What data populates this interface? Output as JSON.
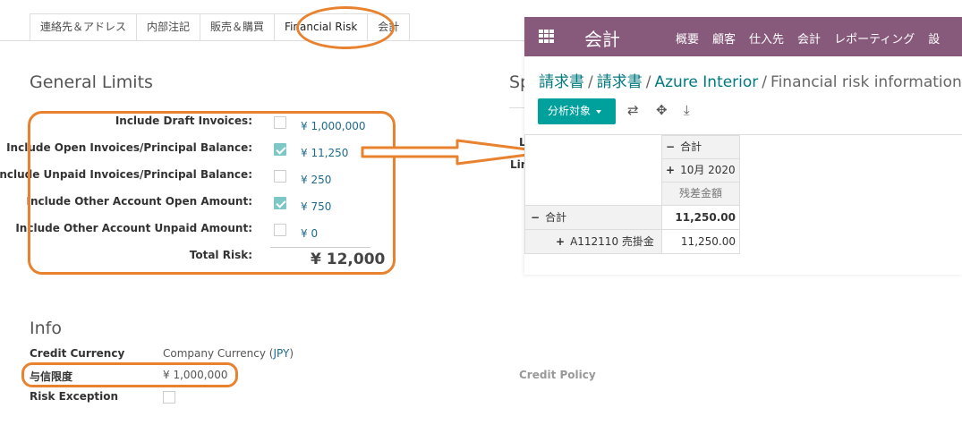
{
  "tabs": [
    "連絡先＆アドレス",
    "内部注記",
    "販売＆購買",
    "Financial Risk",
    "会計"
  ],
  "general_limits": {
    "title": "General Limits",
    "rows": [
      {
        "label": "Include Draft Invoices:",
        "checked": false,
        "amount": "¥ 1,000,000"
      },
      {
        "label": "Include Open Invoices/Principal Balance:",
        "checked": true,
        "amount": "¥ 11,250"
      },
      {
        "label": "Include Unpaid Invoices/Principal Balance:",
        "checked": false,
        "amount": "¥ 250"
      },
      {
        "label": "Include Other Account Open Amount:",
        "checked": true,
        "amount": "¥ 750"
      },
      {
        "label": "Include Other Account Unpaid Amount:",
        "checked": false,
        "amount": "¥ 0"
      }
    ],
    "total_label": "Total Risk:",
    "total_amount": "¥ 12,000"
  },
  "side_section": {
    "title_fragment": "Sp",
    "label_1": "L",
    "label_2": "Lin"
  },
  "info": {
    "title": "Info",
    "credit_currency_label": "Credit Currency",
    "credit_currency_value": "Company Currency (",
    "credit_currency_link": "JPY",
    "credit_currency_close": ")",
    "credit_limit_label": "与信限度",
    "credit_limit_value": "¥ 1,000,000",
    "risk_exception_label": "Risk Exception",
    "credit_policy_label": "Credit Policy"
  },
  "panel": {
    "app_title": "会計",
    "menu": [
      "概要",
      "顧客",
      "仕入先",
      "会計",
      "レポーティング",
      "設"
    ],
    "breadcrumb": [
      "請求書",
      "請求書",
      "Azure Interior",
      "Financial risk information"
    ],
    "analysis_button": "分析対象",
    "icons": [
      "grid-icon",
      "swap-icon",
      "move-icon",
      "download-icon"
    ],
    "pivot": {
      "col_header": "合計",
      "col_sub": "10月 2020",
      "measure": "残差金額",
      "row_header": "合計",
      "row_total": "11,250.00",
      "sub_row_label": "A112110 売掛金",
      "sub_row_value": "11,250.00"
    }
  },
  "colors": {
    "annotation": "#e8822e",
    "topbar": "#875a7b",
    "teal_button": "#00a09d",
    "link": "#00797f"
  }
}
